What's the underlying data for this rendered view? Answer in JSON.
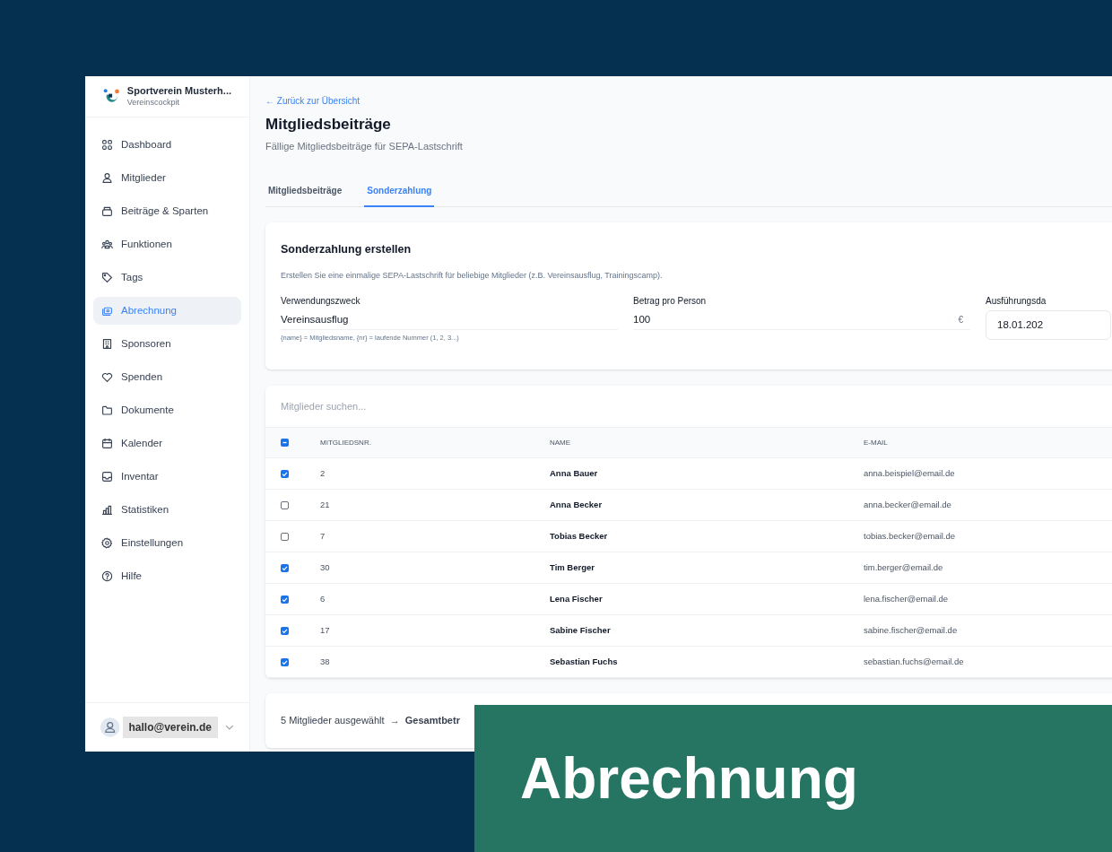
{
  "app": {
    "name": "Sportverein Musterh...",
    "subtitle": "Vereinscockpit"
  },
  "sidebar": {
    "items": [
      {
        "label": "Dashboard",
        "selected": false
      },
      {
        "label": "Mitglieder",
        "selected": false
      },
      {
        "label": "Beiträge & Sparten",
        "selected": false
      },
      {
        "label": "Funktionen",
        "selected": false
      },
      {
        "label": "Tags",
        "selected": false
      },
      {
        "label": "Abrechnung",
        "selected": true
      },
      {
        "label": "Sponsoren",
        "selected": false
      },
      {
        "label": "Spenden",
        "selected": false
      },
      {
        "label": "Dokumente",
        "selected": false
      },
      {
        "label": "Kalender",
        "selected": false
      },
      {
        "label": "Inventar",
        "selected": false
      },
      {
        "label": "Statistiken",
        "selected": false
      },
      {
        "label": "Einstellungen",
        "selected": false
      },
      {
        "label": "Hilfe",
        "selected": false
      }
    ],
    "user": {
      "email": "hallo@verein.de"
    }
  },
  "page": {
    "back_link": "← Zurück zur Übersicht",
    "title": "Mitgliedsbeiträge",
    "subtitle": "Fällige Mitgliedsbeiträge für SEPA-Lastschrift"
  },
  "tabs": [
    {
      "label": "Mitgliedsbeiträge",
      "selected": false
    },
    {
      "label": "Sonderzahlung",
      "selected": true
    }
  ],
  "form": {
    "title": "Sonderzahlung erstellen",
    "description": "Erstellen Sie eine einmalige SEPA-Lastschrift für beliebige Mitglieder (z.B. Vereinsausflug, Trainingscamp).",
    "purpose": {
      "label": "Verwendungszweck",
      "value": "Vereinsausflug",
      "hint": "{name} = Mitgliedsname, {nr} = laufende Nummer (1, 2, 3...)"
    },
    "amount": {
      "label": "Betrag pro Person",
      "value": "100",
      "suffix": "€"
    },
    "date": {
      "label": "Ausführungsda",
      "value": "18.01.202"
    }
  },
  "search": {
    "placeholder": "Mitglieder suchen..."
  },
  "table": {
    "select_all_indeterminate": true,
    "columns": [
      "MITGLIEDSNR.",
      "NAME",
      "E-MAIL"
    ],
    "rows": [
      {
        "checked": true,
        "nr": "2",
        "name": "Anna Bauer",
        "email": "anna.beispiel@email.de"
      },
      {
        "checked": false,
        "nr": "21",
        "name": "Anna Becker",
        "email": "anna.becker@email.de"
      },
      {
        "checked": false,
        "nr": "7",
        "name": "Tobias Becker",
        "email": "tobias.becker@email.de"
      },
      {
        "checked": true,
        "nr": "30",
        "name": "Tim Berger",
        "email": "tim.berger@email.de"
      },
      {
        "checked": true,
        "nr": "6",
        "name": "Lena Fischer",
        "email": "lena.fischer@email.de"
      },
      {
        "checked": true,
        "nr": "17",
        "name": "Sabine Fischer",
        "email": "sabine.fischer@email.de"
      },
      {
        "checked": true,
        "nr": "38",
        "name": "Sebastian Fuchs",
        "email": "sebastian.fuchs@email.de"
      }
    ]
  },
  "summary": "5 Mitglieder ausgewählt  →  **Gesamtbetr**",
  "banner": {
    "title": "Abrechnung"
  }
}
